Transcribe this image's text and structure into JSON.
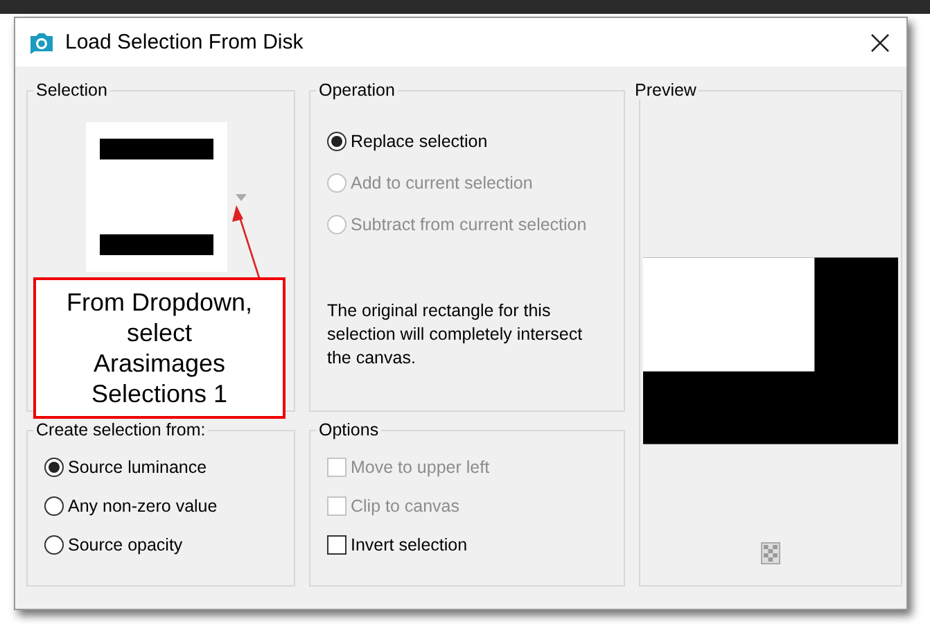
{
  "window": {
    "title": "Load Selection From Disk"
  },
  "selection": {
    "label": "Selection"
  },
  "create_from": {
    "label": "Create selection from:",
    "options": [
      {
        "label": "Source luminance",
        "selected": true
      },
      {
        "label": "Any non-zero value",
        "selected": false
      },
      {
        "label": "Source opacity",
        "selected": false
      }
    ]
  },
  "operation": {
    "label": "Operation",
    "options": [
      {
        "label": "Replace selection",
        "selected": true,
        "disabled": false
      },
      {
        "label": "Add to current selection",
        "selected": false,
        "disabled": true
      },
      {
        "label": "Subtract from current selection",
        "selected": false,
        "disabled": true
      }
    ],
    "note": "The original rectangle for this selection will completely intersect the canvas."
  },
  "options": {
    "label": "Options",
    "items": [
      {
        "label": "Move to upper left",
        "checked": false,
        "disabled": true
      },
      {
        "label": "Clip to canvas",
        "checked": false,
        "disabled": true
      },
      {
        "label": "Invert selection",
        "checked": false,
        "disabled": false
      }
    ]
  },
  "preview": {
    "label": "Preview"
  },
  "callout": {
    "lines": [
      "From Dropdown,",
      "select",
      "Arasimages",
      "Selections 1"
    ]
  }
}
